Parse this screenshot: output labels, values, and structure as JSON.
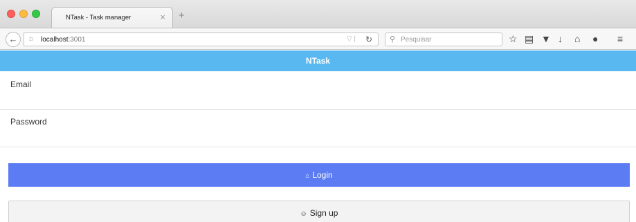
{
  "browser": {
    "tab_title": "NTask - Task manager",
    "tab_close": "×",
    "new_tab": "+",
    "url_host": "localhost",
    "url_port": ":3001",
    "search_placeholder": "Pesquisar",
    "icons": [
      "back-arrow-icon",
      "globe-icon",
      "reload-icon",
      "search-icon",
      "star-icon",
      "reading-list-icon",
      "pocket-icon",
      "download-icon",
      "home-icon",
      "chat-icon",
      "menu-icon"
    ]
  },
  "app": {
    "title": "NTask",
    "header_color": "#5ab8f0"
  },
  "form": {
    "email_label": "Email",
    "email_value": "",
    "password_label": "Password",
    "password_value": "",
    "login_label": "Login",
    "login_color": "#5b7cf2",
    "signup_label": "Sign up"
  }
}
